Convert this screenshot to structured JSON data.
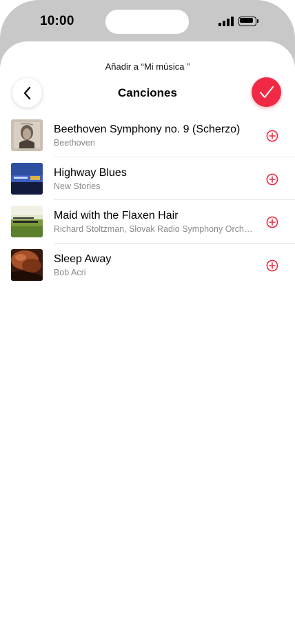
{
  "status_bar": {
    "time": "10:00"
  },
  "header": {
    "subtitle": "Añadir a “Mi música ”",
    "title": "Canciones",
    "back_icon": "chevron-left-icon",
    "done_icon": "checkmark-icon"
  },
  "colors": {
    "accent": "#f02a44",
    "secondary_text": "#8a8a8e"
  },
  "songs": [
    {
      "title": "Beethoven Symphony no. 9 (Scherzo)",
      "artist": "Beethoven"
    },
    {
      "title": "Highway Blues",
      "artist": "New Stories"
    },
    {
      "title": "Maid with the Flaxen Hair",
      "artist": "Richard Stoltzman, Slovak Radio Symphony Orchestra"
    },
    {
      "title": "Sleep Away",
      "artist": "Bob Acri"
    }
  ]
}
